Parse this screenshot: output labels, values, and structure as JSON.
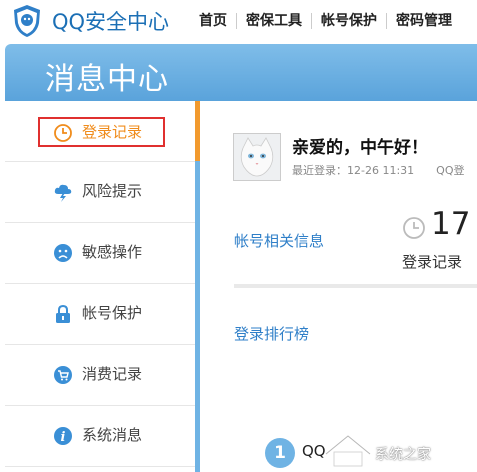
{
  "header": {
    "app_title": "QQ安全中心",
    "nav": [
      "首页",
      "密保工具",
      "帐号保护",
      "密码管理"
    ]
  },
  "banner": {
    "title": "消息中心"
  },
  "sidebar": {
    "items": [
      {
        "label": "登录记录",
        "icon": "clock-icon",
        "active": true
      },
      {
        "label": "风险提示",
        "icon": "cloud-lightning-icon"
      },
      {
        "label": "敏感操作",
        "icon": "sad-face-icon"
      },
      {
        "label": "帐号保护",
        "icon": "lock-icon"
      },
      {
        "label": "消费记录",
        "icon": "cart-icon"
      },
      {
        "label": "系统消息",
        "icon": "info-icon"
      }
    ]
  },
  "main": {
    "greeting": "亲爱的，中午好！",
    "last_login_label": "最近登录：12-26  11:31",
    "last_login_suffix": "QQ登",
    "account_info": "帐号相关信息",
    "login_count": "17",
    "login_count_label": "登录记录",
    "ranking_title": "登录排行榜",
    "rank_number": "1",
    "rank_item": "QQ",
    "watermark": "系统之家"
  },
  "colors": {
    "brand_blue": "#1b6fb5",
    "banner_blue": "#6aaee0",
    "active_orange": "#f08c1c",
    "highlight_red": "#e0302f",
    "link_blue": "#2f7fc8"
  }
}
